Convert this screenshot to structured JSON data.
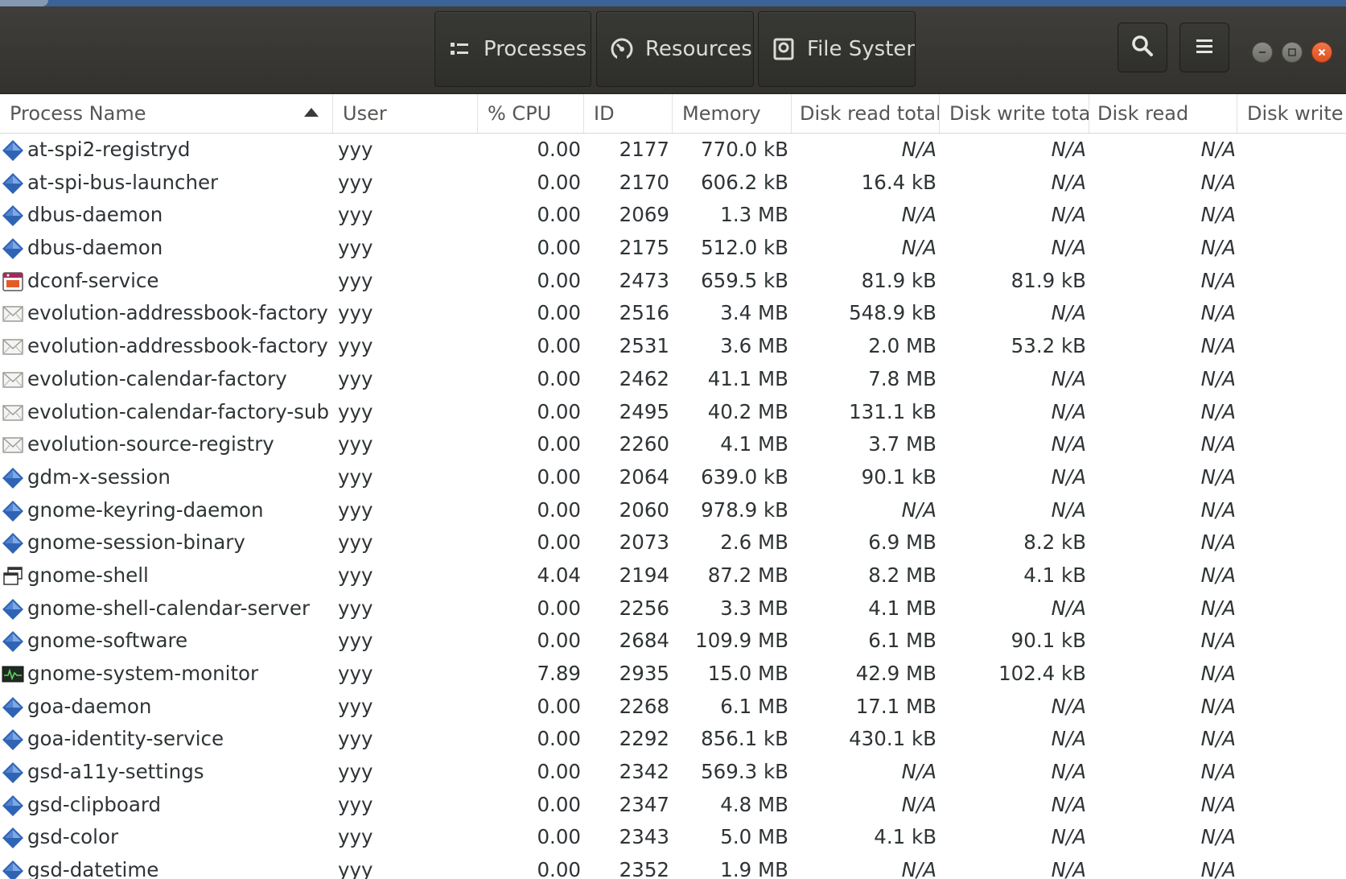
{
  "header": {
    "tabs": [
      {
        "label": "Processes",
        "icon": "process-list-icon"
      },
      {
        "label": "Resources",
        "icon": "gauge-icon"
      },
      {
        "label": "File Systems",
        "icon": "harddisk-icon"
      }
    ],
    "buttons": {
      "search": "search-icon",
      "menu": "hamburger-menu-icon"
    },
    "window_controls": [
      "minimize-icon",
      "maximize-icon",
      "close-icon"
    ]
  },
  "columns": [
    "Process Name",
    "User",
    "% CPU",
    "ID",
    "Memory",
    "Disk read total",
    "Disk write total",
    "Disk read",
    "Disk write"
  ],
  "sort": {
    "column": "Process Name",
    "direction": "ascending"
  },
  "processes": [
    {
      "name": "at-spi2-registryd",
      "user": "yyy",
      "cpu": "0.00",
      "id": "2177",
      "memory": "770.0 kB",
      "disk_read_total": "N/A",
      "disk_write_total": "N/A",
      "disk_read": "N/A",
      "icon": "generic-diamond"
    },
    {
      "name": "at-spi-bus-launcher",
      "user": "yyy",
      "cpu": "0.00",
      "id": "2170",
      "memory": "606.2 kB",
      "disk_read_total": "16.4 kB",
      "disk_write_total": "N/A",
      "disk_read": "N/A",
      "icon": "generic-diamond"
    },
    {
      "name": "dbus-daemon",
      "user": "yyy",
      "cpu": "0.00",
      "id": "2069",
      "memory": "1.3 MB",
      "disk_read_total": "N/A",
      "disk_write_total": "N/A",
      "disk_read": "N/A",
      "icon": "generic-diamond"
    },
    {
      "name": "dbus-daemon",
      "user": "yyy",
      "cpu": "0.00",
      "id": "2175",
      "memory": "512.0 kB",
      "disk_read_total": "N/A",
      "disk_write_total": "N/A",
      "disk_read": "N/A",
      "icon": "generic-diamond"
    },
    {
      "name": "dconf-service",
      "user": "yyy",
      "cpu": "0.00",
      "id": "2473",
      "memory": "659.5 kB",
      "disk_read_total": "81.9 kB",
      "disk_write_total": "81.9 kB",
      "disk_read": "N/A",
      "icon": "dconf"
    },
    {
      "name": "evolution-addressbook-factory",
      "user": "yyy",
      "cpu": "0.00",
      "id": "2516",
      "memory": "3.4 MB",
      "disk_read_total": "548.9 kB",
      "disk_write_total": "N/A",
      "disk_read": "N/A",
      "icon": "evolution"
    },
    {
      "name": "evolution-addressbook-factory",
      "user": "yyy",
      "cpu": "0.00",
      "id": "2531",
      "memory": "3.6 MB",
      "disk_read_total": "2.0 MB",
      "disk_write_total": "53.2 kB",
      "disk_read": "N/A",
      "icon": "evolution"
    },
    {
      "name": "evolution-calendar-factory",
      "user": "yyy",
      "cpu": "0.00",
      "id": "2462",
      "memory": "41.1 MB",
      "disk_read_total": "7.8 MB",
      "disk_write_total": "N/A",
      "disk_read": "N/A",
      "icon": "evolution"
    },
    {
      "name": "evolution-calendar-factory-sub",
      "user": "yyy",
      "cpu": "0.00",
      "id": "2495",
      "memory": "40.2 MB",
      "disk_read_total": "131.1 kB",
      "disk_write_total": "N/A",
      "disk_read": "N/A",
      "icon": "evolution"
    },
    {
      "name": "evolution-source-registry",
      "user": "yyy",
      "cpu": "0.00",
      "id": "2260",
      "memory": "4.1 MB",
      "disk_read_total": "3.7 MB",
      "disk_write_total": "N/A",
      "disk_read": "N/A",
      "icon": "evolution"
    },
    {
      "name": "gdm-x-session",
      "user": "yyy",
      "cpu": "0.00",
      "id": "2064",
      "memory": "639.0 kB",
      "disk_read_total": "90.1 kB",
      "disk_write_total": "N/A",
      "disk_read": "N/A",
      "icon": "generic-diamond"
    },
    {
      "name": "gnome-keyring-daemon",
      "user": "yyy",
      "cpu": "0.00",
      "id": "2060",
      "memory": "978.9 kB",
      "disk_read_total": "N/A",
      "disk_write_total": "N/A",
      "disk_read": "N/A",
      "icon": "generic-diamond"
    },
    {
      "name": "gnome-session-binary",
      "user": "yyy",
      "cpu": "0.00",
      "id": "2073",
      "memory": "2.6 MB",
      "disk_read_total": "6.9 MB",
      "disk_write_total": "8.2 kB",
      "disk_read": "N/A",
      "icon": "generic-diamond"
    },
    {
      "name": "gnome-shell",
      "user": "yyy",
      "cpu": "4.04",
      "id": "2194",
      "memory": "87.2 MB",
      "disk_read_total": "8.2 MB",
      "disk_write_total": "4.1 kB",
      "disk_read": "N/A",
      "icon": "window"
    },
    {
      "name": "gnome-shell-calendar-server",
      "user": "yyy",
      "cpu": "0.00",
      "id": "2256",
      "memory": "3.3 MB",
      "disk_read_total": "4.1 MB",
      "disk_write_total": "N/A",
      "disk_read": "N/A",
      "icon": "generic-diamond"
    },
    {
      "name": "gnome-software",
      "user": "yyy",
      "cpu": "0.00",
      "id": "2684",
      "memory": "109.9 MB",
      "disk_read_total": "6.1 MB",
      "disk_write_total": "90.1 kB",
      "disk_read": "N/A",
      "icon": "generic-diamond"
    },
    {
      "name": "gnome-system-monitor",
      "user": "yyy",
      "cpu": "7.89",
      "id": "2935",
      "memory": "15.0 MB",
      "disk_read_total": "42.9 MB",
      "disk_write_total": "102.4 kB",
      "disk_read": "N/A",
      "icon": "monitor"
    },
    {
      "name": "goa-daemon",
      "user": "yyy",
      "cpu": "0.00",
      "id": "2268",
      "memory": "6.1 MB",
      "disk_read_total": "17.1 MB",
      "disk_write_total": "N/A",
      "disk_read": "N/A",
      "icon": "generic-diamond"
    },
    {
      "name": "goa-identity-service",
      "user": "yyy",
      "cpu": "0.00",
      "id": "2292",
      "memory": "856.1 kB",
      "disk_read_total": "430.1 kB",
      "disk_write_total": "N/A",
      "disk_read": "N/A",
      "icon": "generic-diamond"
    },
    {
      "name": "gsd-a11y-settings",
      "user": "yyy",
      "cpu": "0.00",
      "id": "2342",
      "memory": "569.3 kB",
      "disk_read_total": "N/A",
      "disk_write_total": "N/A",
      "disk_read": "N/A",
      "icon": "generic-diamond"
    },
    {
      "name": "gsd-clipboard",
      "user": "yyy",
      "cpu": "0.00",
      "id": "2347",
      "memory": "4.8 MB",
      "disk_read_total": "N/A",
      "disk_write_total": "N/A",
      "disk_read": "N/A",
      "icon": "generic-diamond"
    },
    {
      "name": "gsd-color",
      "user": "yyy",
      "cpu": "0.00",
      "id": "2343",
      "memory": "5.0 MB",
      "disk_read_total": "4.1 kB",
      "disk_write_total": "N/A",
      "disk_read": "N/A",
      "icon": "generic-diamond"
    },
    {
      "name": "gsd-datetime",
      "user": "yyy",
      "cpu": "0.00",
      "id": "2352",
      "memory": "1.9 MB",
      "disk_read_total": "N/A",
      "disk_write_total": "N/A",
      "disk_read": "N/A",
      "icon": "generic-diamond"
    }
  ],
  "colors": {
    "headerbar": "#35342f",
    "close_button": "#e95420",
    "diamond_icon": "#3465a4"
  }
}
